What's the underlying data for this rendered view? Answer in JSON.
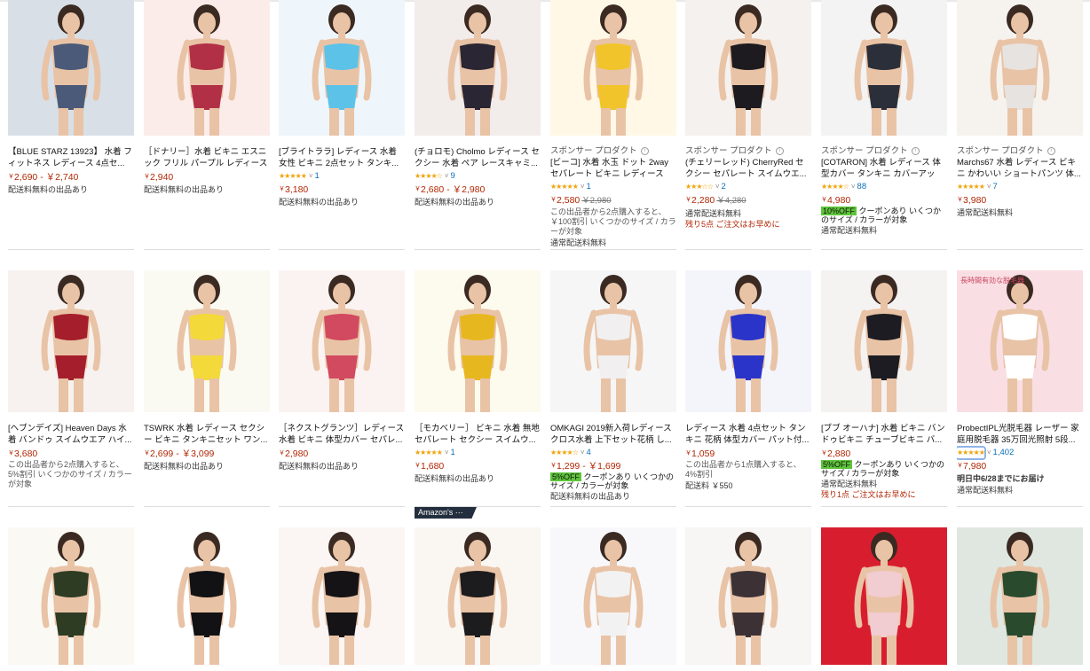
{
  "products": [
    {
      "col": 0,
      "row": 0,
      "img": "#d9dfe6",
      "fig": "#4b5a78",
      "title": "【BLUE STARZ 13923】 水着 フィットネス レディース 4点セ...",
      "price": "2,690 - ￥2,740",
      "ship": "配送料無料の出品あり"
    },
    {
      "col": 1,
      "row": 0,
      "img": "#fbecea",
      "fig": "#b23046",
      "title": "［ドナリー］水着 ビキニ エスニ ック フリル パープル レディース ...",
      "price": "2,940",
      "ship": "配送料無料の出品あり"
    },
    {
      "col": 2,
      "row": 0,
      "img": "#eef6fb",
      "fig": "#5cc2e8",
      "title": "[ブライトララ] レディース 水着 女性 ビキニ 2点セット タンキ...",
      "rating": "5",
      "count": "1",
      "price": "3,180",
      "ship": "配送料無料の出品あり"
    },
    {
      "col": 3,
      "row": 0,
      "img": "#f2ecea",
      "fig": "#2a2633",
      "title": "(チョロモ) Cholmo レディース セクシー 水着 ペア レースキャミ...",
      "rating": "4",
      "count": "9",
      "price": "2,680 - ￥2,980",
      "ship": "配送料無料の出品あり"
    },
    {
      "col": 4,
      "row": 0,
      "img": "#fff8e6",
      "fig": "#f1c42b",
      "sponsor": "スポンサー プロダクト",
      "title": "[ビーコ] 水着 水玉 ドット 2way セパレート ビキニ レディース",
      "rating": "5",
      "count": "1",
      "price": "2,580",
      "old": "￥2,980",
      "note": "この出品者から2点購入すると、￥100割引 いくつかのサイズ / カラーが対象",
      "ship": "通常配送料無料"
    },
    {
      "col": 5,
      "row": 0,
      "img": "#f5f1ee",
      "fig": "#1d1b1f",
      "sponsor": "スポンサー プロダクト",
      "title": "(チェリーレッド) CherryRed セクシー セパレート スイムウエ...",
      "rating": "3",
      "count": "2",
      "price": "2,280",
      "old": "￥4,280",
      "ship": "通常配送料無料",
      "stock": "残り5点 ご注文はお早めに"
    },
    {
      "col": 6,
      "row": 0,
      "img": "#f3f3f4",
      "fig": "#2b2f3a",
      "sponsor": "スポンサー プロダクト",
      "title": "[COTARON] 水着 レディース 体型カバー タンキニ カバーアップ...",
      "rating": "4",
      "count": "88",
      "price": "4,980",
      "coupon": "10%OFF",
      "coupontext": "クーポンあり いくつかのサイズ / カラーが対象",
      "ship": "通常配送料無料"
    },
    {
      "col": 7,
      "row": 0,
      "img": "#f6f3ef",
      "fig": "#e7e3e0",
      "sponsor": "スポンサー プロダクト",
      "title": "Marchs67 水着 レディース ビキニ かわいい ショートパンツ 体...",
      "rating": "5",
      "count": "7",
      "price": "3,980",
      "ship": "通常配送料無料"
    },
    {
      "col": 0,
      "row": 1,
      "img": "#f7f2ef",
      "fig": "#a51e2b",
      "title": "[ヘブンデイズ] Heaven Days 水着 バンドゥ スイムウエア ハイ...",
      "price": "3,680",
      "note": "この出品者から2点購入すると、5%割引 いくつかのサイズ / カラーが対象"
    },
    {
      "col": 1,
      "row": 1,
      "img": "#fafaf3",
      "fig": "#f4d93b",
      "title": "TSWRK 水着 レディース セクシー ビキニ タンキニセット ワン...",
      "price": "2,699 - ￥3,099",
      "ship": "配送料無料の出品あり"
    },
    {
      "col": 2,
      "row": 1,
      "img": "#fbf3f1",
      "fig": "#d14a5f",
      "title": "［ネクストグランツ］レディース 水着 ビキニ 体型カバー セパレ...",
      "price": "2,980",
      "ship": "配送料無料の出品あり"
    },
    {
      "col": 3,
      "row": 1,
      "img": "#fdfaee",
      "fig": "#e7b71f",
      "title": "［モカベリー］ ビキニ 水着 無地 セパレート セクシー スイムウ...",
      "rating": "5",
      "count": "1",
      "price": "1,680",
      "ship": "配送料無料の出品あり"
    },
    {
      "col": 4,
      "row": 1,
      "img": "#f6f6f6",
      "fig": "#f1eff0",
      "title": "OMKAGI 2019新入荷レディース クロス水着 上下セット花柄 し...",
      "rating": "4",
      "count": "4",
      "price": "1,299 - ￥1,699",
      "coupon": "5%OFF",
      "coupontext": "クーポンあり いくつかのサイズ / カラーが対象",
      "ship": "配送料無料の出品あり"
    },
    {
      "col": 5,
      "row": 1,
      "img": "#f4f5fb",
      "fig": "#2a34c8",
      "title": "レディース 水着 4点セット タンキニ 花柄 体型カバー パット付...",
      "price": "1,059",
      "note": "この出品者から1点購入すると、4%割引",
      "ship": "配送料 ￥550"
    },
    {
      "col": 6,
      "row": 1,
      "img": "#f5f2f2",
      "fig": "#1c1c22",
      "title": "[ブブ オーハナ] 水着 ビキニ バンドゥビキニ チューブビキニ バ...",
      "price": "2,880",
      "coupon": "5%OFF",
      "coupontext": "クーポンあり いくつかのサイズ / カラーが対象",
      "ship": "通常配送料無料",
      "stock": "残り1点 ご注文はお早めに"
    },
    {
      "col": 7,
      "row": 1,
      "img": "#f9dfe4",
      "fig": "#ffffff",
      "title": "ProbectIPL光脱毛器 レーザー 家庭用脱毛器 35万回光照射 5段...",
      "rating": "5",
      "count": "1,402",
      "price": "7,980",
      "delivery": "明日中6/28までにお届け",
      "ship": "通常配送料無料",
      "label": "長時間有効な脱毛器"
    },
    {
      "col": 0,
      "row": 2,
      "img": "#fbf9f3",
      "fig": "#2e3c24"
    },
    {
      "col": 1,
      "row": 2,
      "img": "#ffffff",
      "fig": "#121214"
    },
    {
      "col": 2,
      "row": 2,
      "img": "#fbf6f3",
      "fig": "#151316"
    },
    {
      "col": 3,
      "row": 2,
      "img": "#faf7f3",
      "fig": "#1c1b1d"
    },
    {
      "col": 4,
      "row": 2,
      "img": "#f8f8fa",
      "fig": "#f2f2f2"
    },
    {
      "col": 5,
      "row": 2,
      "img": "#f8f6f4",
      "fig": "#3c3236"
    },
    {
      "col": 6,
      "row": 2,
      "img": "#d81e2e",
      "fig": "#f1ccd0"
    },
    {
      "col": 7,
      "row": 2,
      "img": "#dfe7e0",
      "fig": "#2a4a2e"
    }
  ],
  "amazon_badge": "Amazon's ···",
  "colors": {
    "price": "#b12704",
    "link": "#0b6fb8",
    "star": "#f0a30a",
    "coupon": "#5ec53a"
  }
}
